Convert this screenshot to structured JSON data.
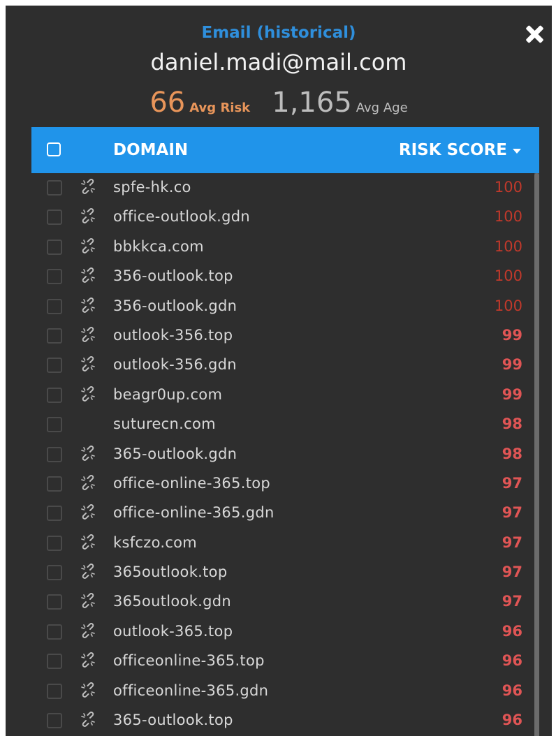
{
  "header": {
    "title": "Email (historical)",
    "email": "daniel.madi@mail.com",
    "avg_risk_value": "66",
    "avg_risk_label": "Avg Risk",
    "avg_age_value": "1,165",
    "avg_age_label": "Avg Age"
  },
  "table": {
    "col_domain": "DOMAIN",
    "col_risk": "RISK SCORE",
    "rows": [
      {
        "domain": "spfe-hk.co",
        "score": "100",
        "linked": true
      },
      {
        "domain": "office-outlook.gdn",
        "score": "100",
        "linked": true
      },
      {
        "domain": "bbkkca.com",
        "score": "100",
        "linked": true
      },
      {
        "domain": "356-outlook.top",
        "score": "100",
        "linked": true
      },
      {
        "domain": "356-outlook.gdn",
        "score": "100",
        "linked": true
      },
      {
        "domain": "outlook-356.top",
        "score": "99",
        "linked": true
      },
      {
        "domain": "outlook-356.gdn",
        "score": "99",
        "linked": true
      },
      {
        "domain": "beagr0up.com",
        "score": "99",
        "linked": true
      },
      {
        "domain": "suturecn.com",
        "score": "98",
        "linked": false
      },
      {
        "domain": "365-outlook.gdn",
        "score": "98",
        "linked": true
      },
      {
        "domain": "office-online-365.top",
        "score": "97",
        "linked": true
      },
      {
        "domain": "office-online-365.gdn",
        "score": "97",
        "linked": true
      },
      {
        "domain": "ksfczo.com",
        "score": "97",
        "linked": true
      },
      {
        "domain": "365outlook.top",
        "score": "97",
        "linked": true
      },
      {
        "domain": "365outlook.gdn",
        "score": "97",
        "linked": true
      },
      {
        "domain": "outlook-365.top",
        "score": "96",
        "linked": true
      },
      {
        "domain": "officeonline-365.top",
        "score": "96",
        "linked": true
      },
      {
        "domain": "officeonline-365.gdn",
        "score": "96",
        "linked": true
      },
      {
        "domain": "365-outlook.top",
        "score": "96",
        "linked": true
      }
    ]
  },
  "colors": {
    "panel_bg": "#2e2e2e",
    "header_accent": "#2094ea",
    "title": "#2f8fdc",
    "avg_risk": "#e8955a",
    "score_100": "#c0392b",
    "score_other": "#e05555"
  },
  "icons": {
    "close": "close-icon",
    "unlink": "broken-link-icon",
    "sort": "caret-down-icon"
  }
}
